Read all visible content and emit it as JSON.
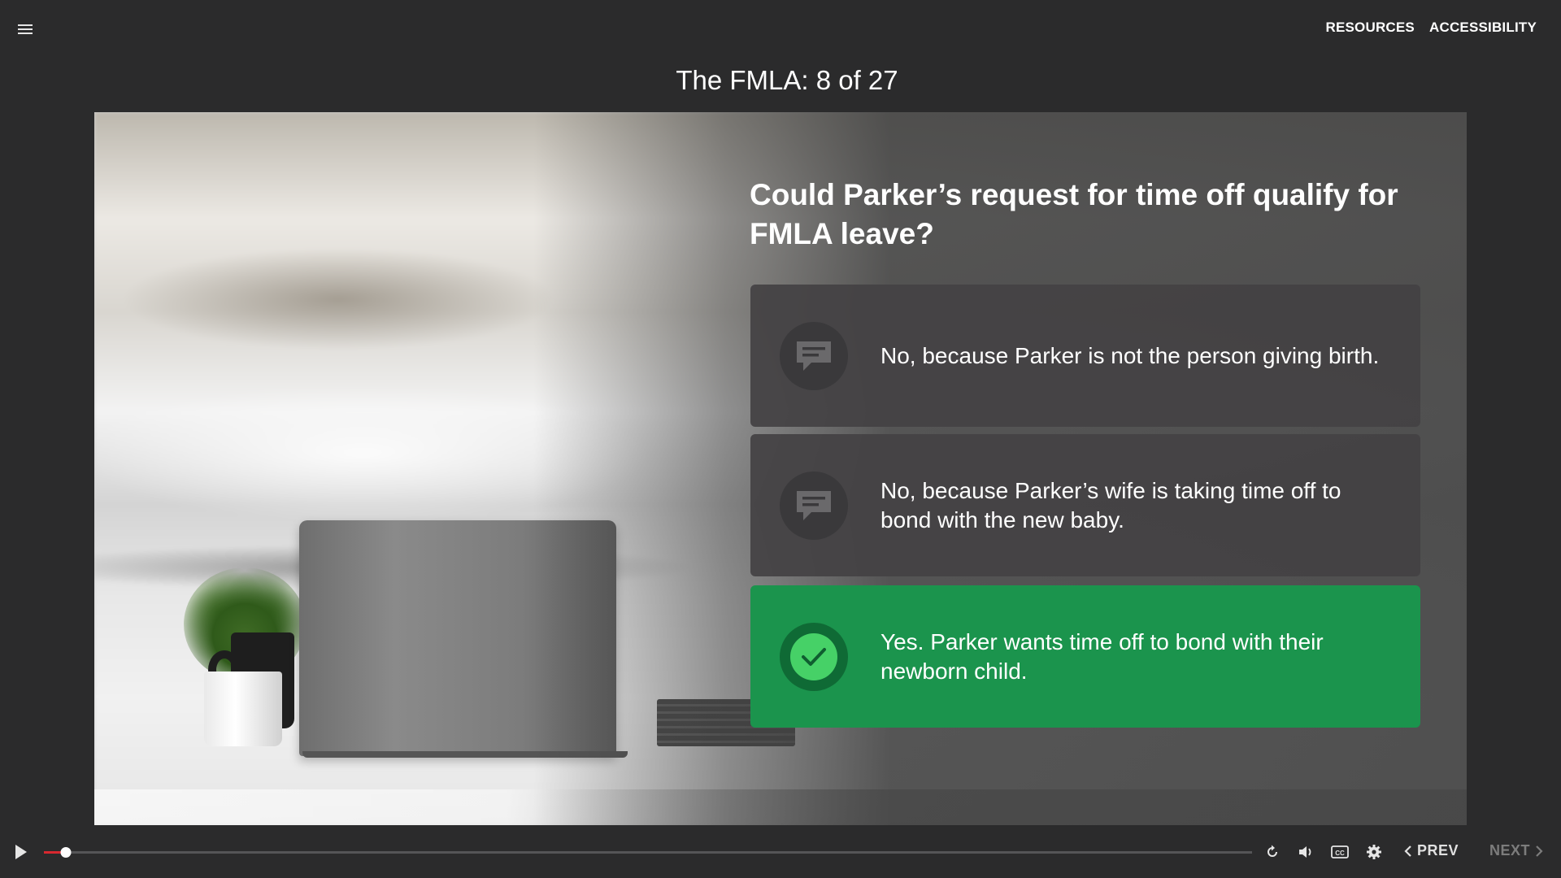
{
  "header": {
    "menu_icon": "hamburger-menu-icon",
    "links": [
      "RESOURCES",
      "ACCESSIBILITY"
    ]
  },
  "slide": {
    "title": "The FMLA: 8 of 27",
    "question": "Could Parker’s request for time off qualify for FMLA leave?",
    "options": [
      {
        "text": "No, because Parker is not the person giving birth.",
        "icon": "chat-bubble-icon",
        "state": "incorrect"
      },
      {
        "text": "No, because Parker’s wife is taking time off to bond with the new baby.",
        "icon": "chat-bubble-icon",
        "state": "incorrect"
      },
      {
        "text": "Yes. Parker wants time off to bond with their newborn child.",
        "icon": "checkmark-icon",
        "state": "correct"
      }
    ]
  },
  "player": {
    "progress": 0.018,
    "prev_label": "PREV",
    "next_label": "NEXT",
    "colors": {
      "progress": "#d8282f",
      "correct": "#1b944d",
      "check": "#46d167",
      "background": "#2b2b2c"
    }
  }
}
